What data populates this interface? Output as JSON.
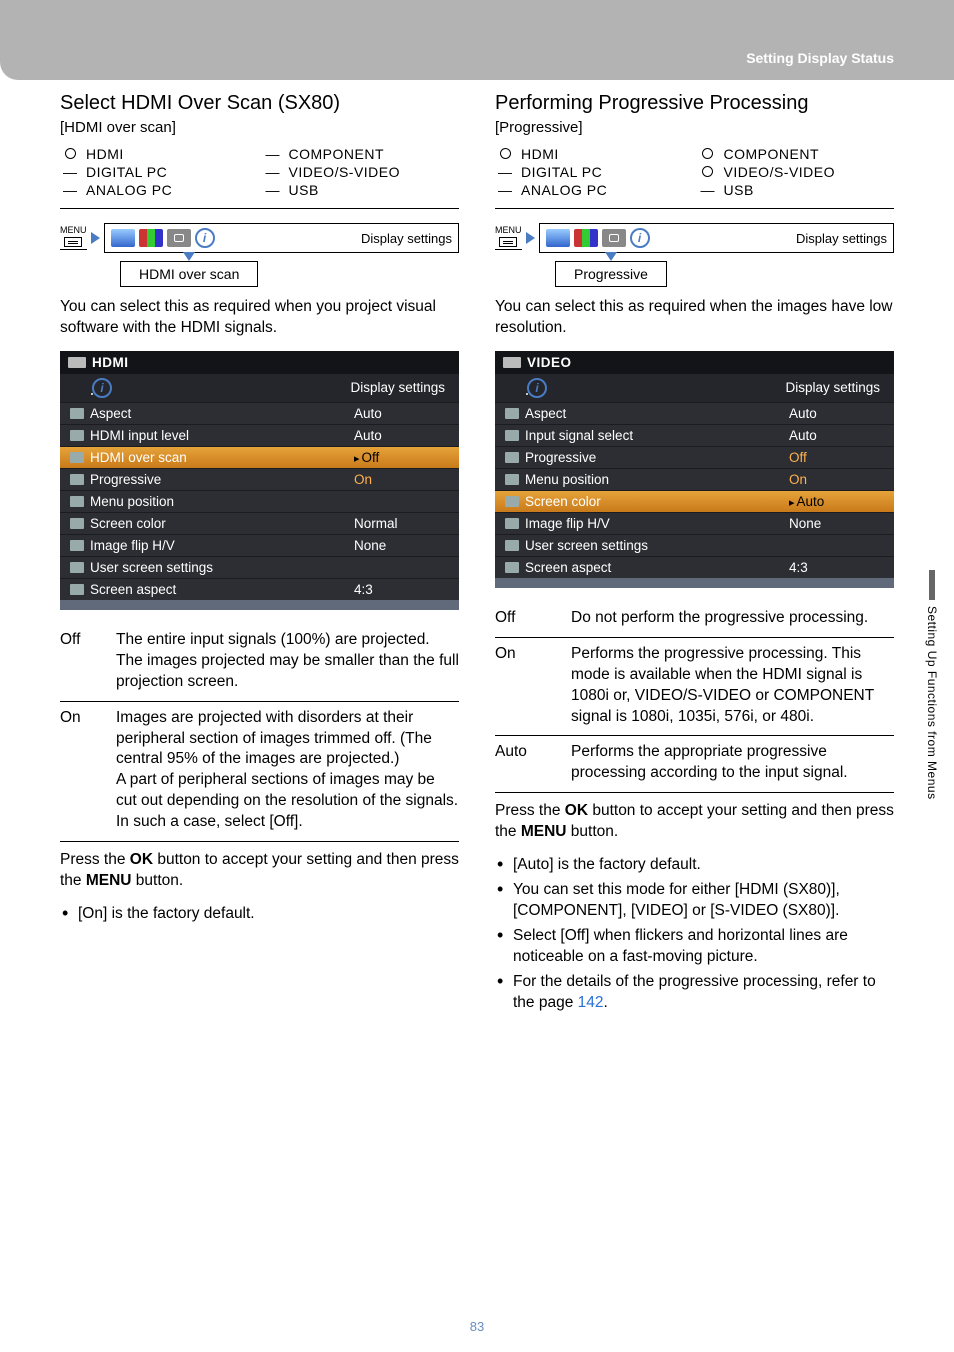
{
  "header": {
    "label": "Setting Display Status"
  },
  "sideTab": "Setting Up Functions from Menus",
  "pageNumber": "83",
  "left": {
    "heading": "Select HDMI Over Scan (SX80)",
    "tag": "[HDMI over scan]",
    "avail": {
      "hdmi": {
        "mark": "circ",
        "name": "HDMI"
      },
      "component": {
        "mark": "dash",
        "name": "COMPONENT"
      },
      "digitalpc": {
        "mark": "dash",
        "name": "DIGITAL PC"
      },
      "videos": {
        "mark": "dash",
        "name": "VIDEO/S-VIDEO"
      },
      "analogpc": {
        "mark": "dash",
        "name": "ANALOG PC"
      },
      "usb": {
        "mark": "dash",
        "name": "USB"
      }
    },
    "menuLabel": "MENU",
    "tabStripLabel": "Display settings",
    "childLabel": "HDMI over scan",
    "para1": "You can select this as required when you project visual software with the HDMI signals.",
    "osd": {
      "title": "HDMI",
      "tabsLabel": "Display settings",
      "rows": [
        {
          "k": "Aspect",
          "v": "Auto"
        },
        {
          "k": "HDMI input level",
          "v": "Auto"
        },
        {
          "k": "HDMI over scan",
          "v": "Off",
          "hi": true,
          "arrow": true
        },
        {
          "k": "Progressive",
          "v": "On",
          "orange": true
        },
        {
          "k": "Menu position",
          "v": ""
        },
        {
          "k": "Screen color",
          "v": "Normal"
        },
        {
          "k": "Image flip H/V",
          "v": "None"
        },
        {
          "k": "User screen settings",
          "v": ""
        },
        {
          "k": "Screen aspect",
          "v": "4:3"
        }
      ]
    },
    "defs": [
      {
        "k": "Off",
        "v": "The entire input signals (100%) are projected.\nThe images projected may be smaller than the full projection screen."
      },
      {
        "k": "On",
        "v": "Images are projected with disorders at their peripheral section of images trimmed off. (The central 95% of the images are projected.)\nA part of peripheral sections of images may be cut out depending on the resolution of the signals. In such a case, select [Off]."
      }
    ],
    "accept1": "Press the ",
    "acceptOK": "OK",
    "accept2": " button to accept your setting and then press the ",
    "acceptMENU": "MENU",
    "accept3": " button.",
    "bullets": [
      "[On] is the factory default."
    ]
  },
  "right": {
    "heading": "Performing Progressive Processing",
    "tag": "[Progressive]",
    "avail": {
      "hdmi": {
        "mark": "circ",
        "name": "HDMI"
      },
      "component": {
        "mark": "circ",
        "name": "COMPONENT"
      },
      "digitalpc": {
        "mark": "dash",
        "name": "DIGITAL PC"
      },
      "videos": {
        "mark": "circ",
        "name": "VIDEO/S-VIDEO"
      },
      "analogpc": {
        "mark": "dash",
        "name": "ANALOG PC"
      },
      "usb": {
        "mark": "dash",
        "name": "USB"
      }
    },
    "menuLabel": "MENU",
    "tabStripLabel": "Display settings",
    "childLabel": "Progressive",
    "para1": "You can select this as required when the images have low resolution.",
    "osd": {
      "title": "VIDEO",
      "tabsLabel": "Display settings",
      "rows": [
        {
          "k": "Aspect",
          "v": "Auto"
        },
        {
          "k": "Input signal select",
          "v": "Auto"
        },
        {
          "k": "Progressive",
          "v": "Off",
          "orange": true
        },
        {
          "k": "Menu position",
          "v": "On",
          "orange": true
        },
        {
          "k": "Screen color",
          "v": "Auto",
          "hi": true,
          "arrow": true
        },
        {
          "k": "Image flip H/V",
          "v": "None"
        },
        {
          "k": "User screen settings",
          "v": ""
        },
        {
          "k": "Screen aspect",
          "v": "4:3"
        }
      ]
    },
    "defs": [
      {
        "k": "Off",
        "v": "Do not perform the progressive processing."
      },
      {
        "k": "On",
        "v": "Performs the progressive processing. This mode is available when the HDMI signal is 1080i or, VIDEO/S-VIDEO or COMPONENT signal is 1080i, 1035i, 576i, or 480i."
      },
      {
        "k": "Auto",
        "v": "Performs the appropriate progressive processing according to the input signal."
      }
    ],
    "accept1": "Press the ",
    "acceptOK": "OK",
    "accept2": " button to accept your setting and then press the ",
    "acceptMENU": "MENU",
    "accept3": " button.",
    "bullets": [
      "[Auto] is the factory default.",
      "You can set this mode for either [HDMI (SX80)], [COMPONENT], [VIDEO] or [S-VIDEO (SX80)].",
      "Select [Off] when flickers and horizontal lines are noticeable on a fast-moving picture.",
      "For the details of the progressive processing, refer to the page "
    ],
    "pageRef": "142",
    "bulletTail": "."
  }
}
